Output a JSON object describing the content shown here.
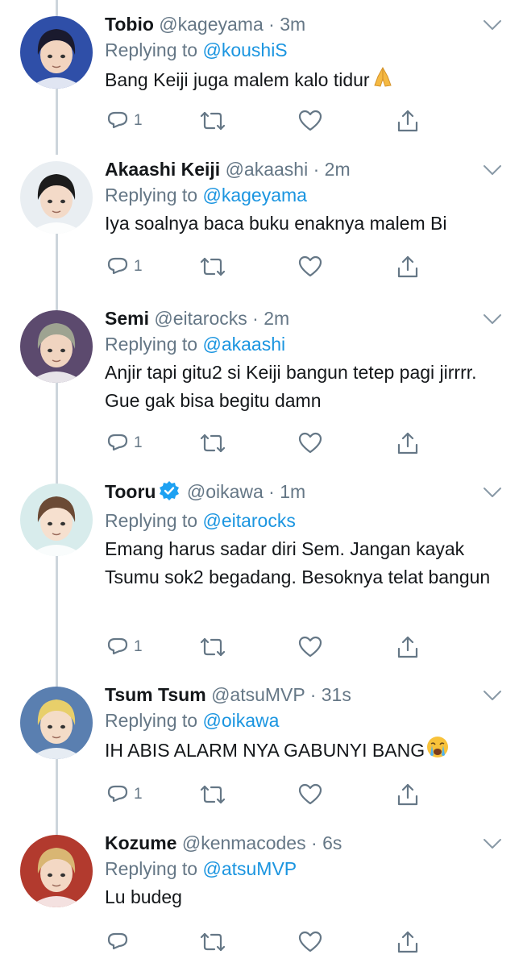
{
  "reply_prefix": "Replying to",
  "colors": {
    "accent": "#1b95e0",
    "muted": "#657786",
    "text": "#14171a",
    "thread_line": "#cdd5dc"
  },
  "tweets": [
    {
      "name": "Tobio",
      "handle": "@kageyama",
      "time": "3m",
      "replying_to": "@koushiS",
      "text": "Bang Keiji juga malem kalo tidur",
      "emoji": "folded-hands-emoji",
      "reply_count": "1",
      "avatar": {
        "icon": "avatar-tobio",
        "hair": "#1a1a2e",
        "skin": "#f2d4bf",
        "bg": "#2f4fa8"
      }
    },
    {
      "name": "Akaashi Keiji",
      "handle": "@akaashi",
      "time": "2m",
      "replying_to": "@kageyama",
      "text": "Iya soalnya baca buku enaknya malem Bi",
      "reply_count": "1",
      "avatar": {
        "icon": "avatar-akaashi",
        "hair": "#1c1c1c",
        "skin": "#f3dac8",
        "bg": "#e9eef2"
      }
    },
    {
      "name": "Semi",
      "handle": "@eitarocks",
      "time": "2m",
      "replying_to": "@akaashi",
      "text": "Anjir tapi gitu2 si Keiji bangun tetep pagi jirrrr. Gue gak bisa begitu damn",
      "reply_count": "1",
      "avatar": {
        "icon": "avatar-semi",
        "hair": "#9ea391",
        "skin": "#f0d4c0",
        "bg": "#5c4a6e"
      }
    },
    {
      "name": "Tooru",
      "handle": "@oikawa",
      "time": "1m",
      "replying_to": "@eitarocks",
      "text": "Emang harus sadar diri Sem. Jangan kayak Tsumu sok2 begadang. Besoknya telat bangun",
      "verified": true,
      "reply_count": "1",
      "avatar": {
        "icon": "avatar-tooru",
        "hair": "#6b4a35",
        "skin": "#f6e0cf",
        "bg": "#d8ecec"
      }
    },
    {
      "name": "Tsum Tsum",
      "handle": "@atsuMVP",
      "time": "31s",
      "replying_to": "@oikawa",
      "text": "IH ABIS ALARM NYA GABUNYI BANG",
      "emoji": "crying-face-emoji",
      "reply_count": "1",
      "avatar": {
        "icon": "avatar-tsum",
        "hair": "#e8cf6a",
        "skin": "#f4dcc7",
        "bg": "#5a7fb0"
      }
    },
    {
      "name": "Kozume",
      "handle": "@kenmacodes",
      "time": "6s",
      "replying_to": "@atsuMVP",
      "text": "Lu budeg",
      "reply_count": "",
      "avatar": {
        "icon": "avatar-kozume",
        "hair": "#d9b673",
        "skin": "#f3d8c4",
        "bg": "#b23a2e"
      }
    }
  ]
}
